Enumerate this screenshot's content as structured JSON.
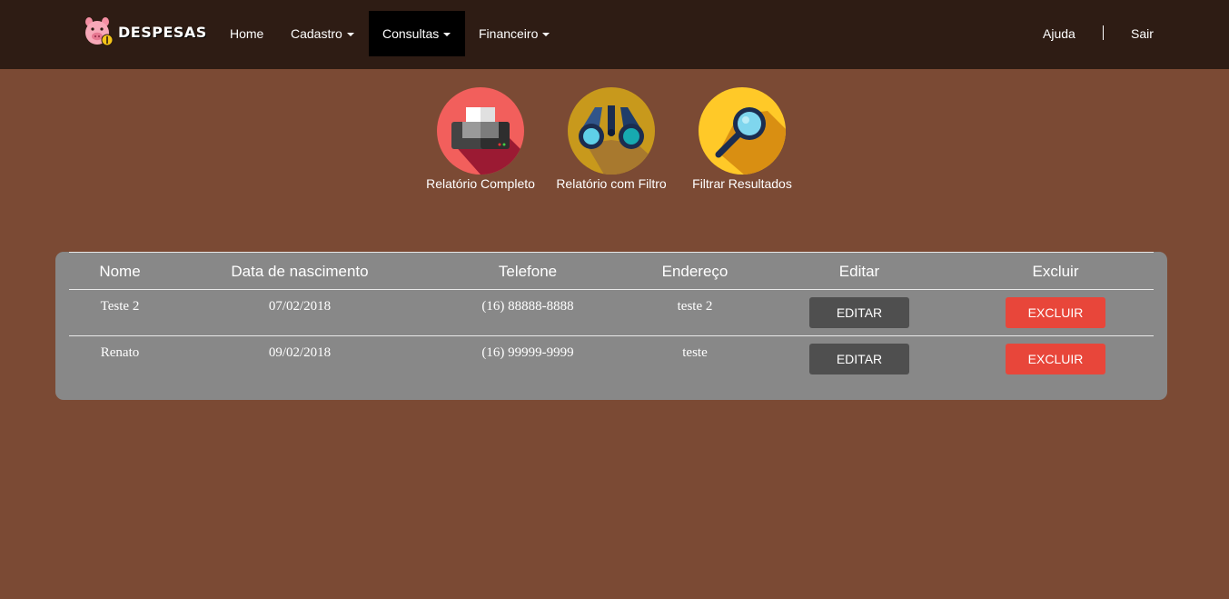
{
  "brand": {
    "name": "DESPESAS",
    "icon": "pig-icon"
  },
  "nav": {
    "home": "Home",
    "cadastro": "Cadastro",
    "consultas": "Consultas",
    "financeiro": "Financeiro",
    "ajuda": "Ajuda",
    "sair": "Sair",
    "active": "Consultas"
  },
  "shortcuts": [
    {
      "label": "Relatório Completo",
      "icon": "printer-icon",
      "color": "#f25f5c"
    },
    {
      "label": "Relatório com Filtro",
      "icon": "binoculars-icon",
      "color": "#c8991c"
    },
    {
      "label": "Filtrar Resultados",
      "icon": "magnifier-icon",
      "color": "#ffc928"
    }
  ],
  "table": {
    "headers": [
      "Nome",
      "Data de nascimento",
      "Telefone",
      "Endereço",
      "Editar",
      "Excluir"
    ],
    "rows": [
      {
        "nome": "Teste 2",
        "data": "07/02/2018",
        "telefone": "(16) 88888-8888",
        "endereco": "teste 2",
        "editar": "EDITAR",
        "excluir": "EXCLUIR"
      },
      {
        "nome": "Renato",
        "data": "09/02/2018",
        "telefone": "(16) 99999-9999",
        "endereco": "teste",
        "editar": "EDITAR",
        "excluir": "EXCLUIR"
      }
    ]
  },
  "colors": {
    "background": "#7b4a34",
    "navbar": "#2e1c14",
    "panel": "#888888",
    "edit_button": "#4f4f4f",
    "delete_button": "#e8463a"
  }
}
